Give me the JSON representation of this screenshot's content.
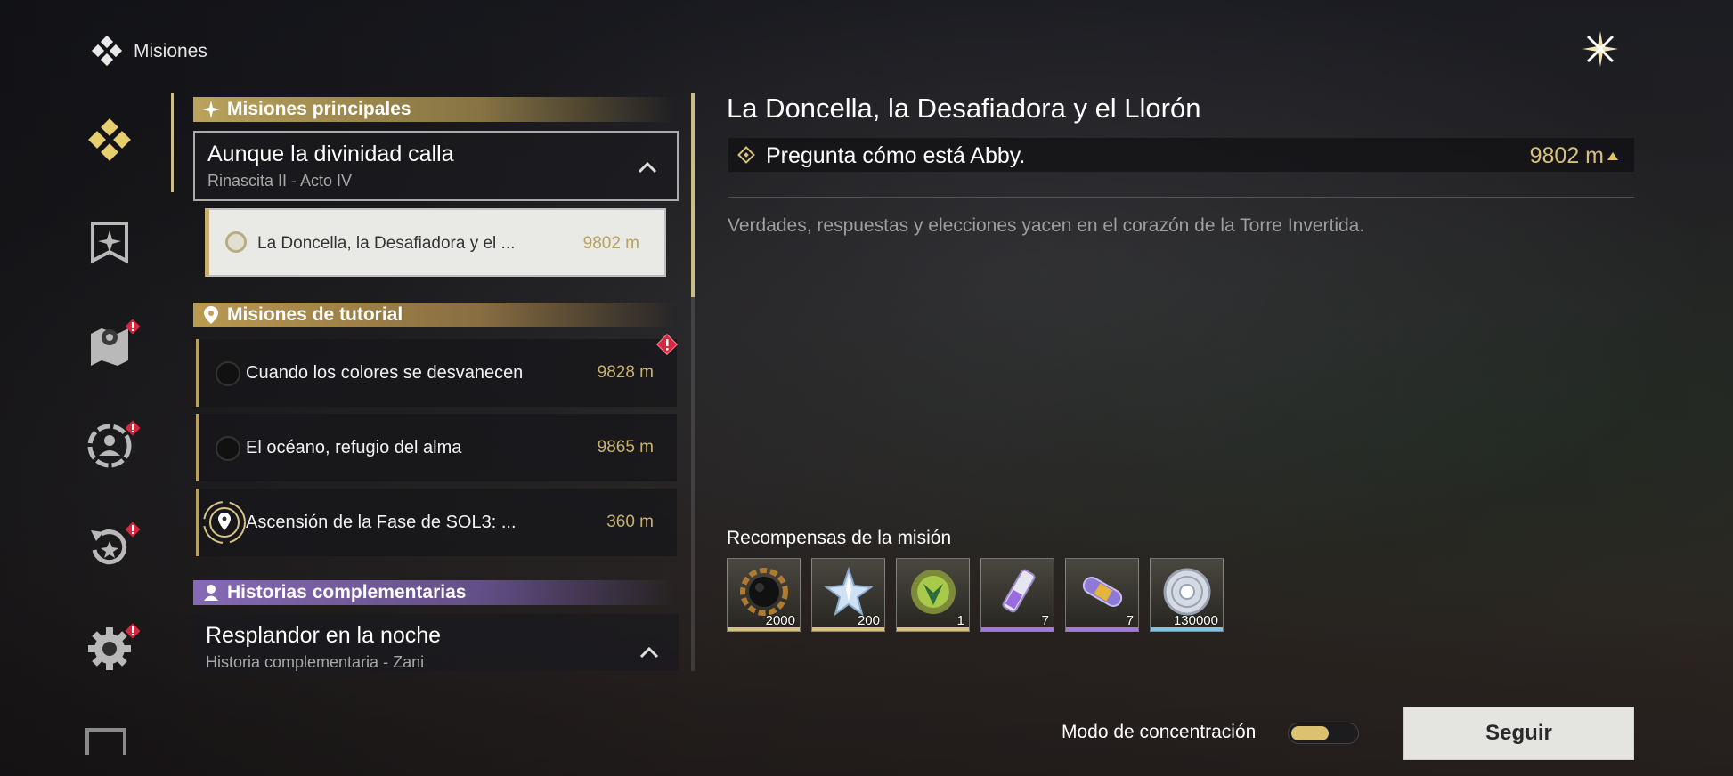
{
  "header": {
    "title": "Misiones",
    "logo_icon": "diamond-cluster-icon",
    "close_icon": "close-star-icon"
  },
  "sidebar": {
    "items": [
      {
        "name": "quests",
        "icon": "diamond-cluster-icon",
        "active": true,
        "alert": false
      },
      {
        "name": "achievements",
        "icon": "banner-icon",
        "active": false,
        "alert": false
      },
      {
        "name": "map",
        "icon": "map-pin-icon",
        "active": false,
        "alert": true
      },
      {
        "name": "character",
        "icon": "person-gear-icon",
        "active": false,
        "alert": true
      },
      {
        "name": "events",
        "icon": "refresh-star-icon",
        "active": false,
        "alert": true
      },
      {
        "name": "settings",
        "icon": "gear-icon",
        "active": false,
        "alert": true
      }
    ]
  },
  "quest_list": {
    "sections": [
      {
        "label": "Misiones principales",
        "icon": "sparkle-icon",
        "color": "#c3aa5f",
        "chapter": {
          "title": "Aunque la divinidad calla",
          "subtitle": "Rinascita II - Acto IV"
        },
        "quests": [
          {
            "title": "La Doncella, la Desafiadora y el ...",
            "distance": "9802 m",
            "selected": true
          }
        ]
      },
      {
        "label": "Misiones de tutorial",
        "icon": "location-pin-icon",
        "color": "#c3a055",
        "quests": [
          {
            "title": "Cuando los colores se desvanecen",
            "distance": "9828 m",
            "alert": true
          },
          {
            "title": "El océano, refugio del alma",
            "distance": "9865 m"
          },
          {
            "title": "Ascensión de la Fase de SOL3: ...",
            "distance": "360 m",
            "tracked": true
          }
        ]
      },
      {
        "label": "Historias complementarias",
        "icon": "person-icon",
        "color": "#8c6ebe",
        "chapter": {
          "title": "Resplandor en la noche",
          "subtitle": "Historia complementaria - Zani"
        }
      }
    ]
  },
  "detail": {
    "title": "La Doncella, la Desafiadora y el Llorón",
    "objective": {
      "text": "Pregunta cómo está Abby.",
      "distance": "9802 m"
    },
    "description": "Verdades, respuestas y elecciones yacen en el corazón de la Torre Invertida.",
    "rewards_label": "Recompensas de la misión",
    "rewards": [
      {
        "icon": "dark-gear-orb-icon",
        "quantity": "2000",
        "rarity_color": "#d8c27a"
      },
      {
        "icon": "star-crystal-icon",
        "quantity": "200",
        "rarity_color": "#d8c27a"
      },
      {
        "icon": "green-emblem-icon",
        "quantity": "1",
        "rarity_color": "#d8c27a"
      },
      {
        "icon": "purple-vial-icon",
        "quantity": "7",
        "rarity_color": "#a676e0"
      },
      {
        "icon": "purple-capsule-icon",
        "quantity": "7",
        "rarity_color": "#a676e0"
      },
      {
        "icon": "silver-coin-icon",
        "quantity": "130000",
        "rarity_color": "#7fc4e6"
      }
    ]
  },
  "footer": {
    "focus_mode_label": "Modo de concentración",
    "focus_mode_on": true,
    "follow_button": "Seguir"
  }
}
